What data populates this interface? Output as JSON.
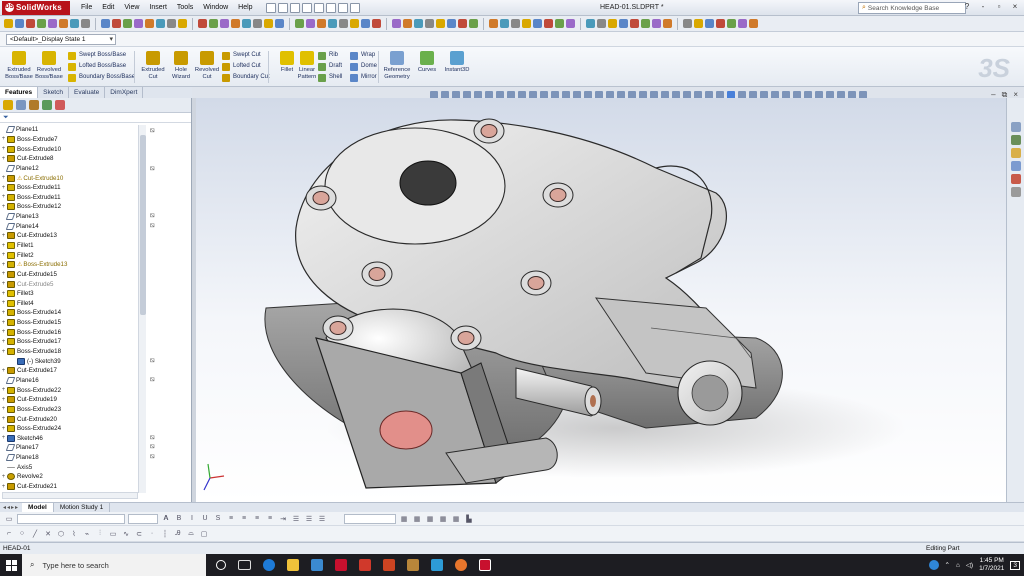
{
  "app": {
    "brand": "SolidWorks",
    "document_title": "HEAD-01.SLDPRT *",
    "menus": [
      "File",
      "Edit",
      "View",
      "Insert",
      "Tools",
      "Window",
      "Help"
    ],
    "search_placeholder": "Search Knowledge Base",
    "window_controls": [
      "?",
      "-",
      "▫",
      "×"
    ]
  },
  "config": {
    "value": "<Default>_Display State 1"
  },
  "ribbon": {
    "big_buttons": [
      {
        "label": "Extruded Boss/Base",
        "color": "#d8b400"
      },
      {
        "label": "Revolved Boss/Base",
        "color": "#d8b400"
      },
      {
        "label": "Extruded Cut",
        "color": "#c89a00"
      },
      {
        "label": "Hole Wizard",
        "color": "#c89a00"
      },
      {
        "label": "Revolved Cut",
        "color": "#c89a00"
      },
      {
        "label": "Fillet",
        "color": "#e0c000"
      },
      {
        "label": "Linear Pattern",
        "color": "#e0c000"
      },
      {
        "label": "Reference Geometry",
        "color": "#7aa0d0"
      },
      {
        "label": "Curves",
        "color": "#6ab04c"
      },
      {
        "label": "Instant3D",
        "color": "#5aa0d0"
      }
    ],
    "small_buttons": [
      {
        "label": "Swept Boss/Base"
      },
      {
        "label": "Lofted Boss/Base"
      },
      {
        "label": "Boundary Boss/Base"
      },
      {
        "label": "Swept Cut"
      },
      {
        "label": "Lofted Cut"
      },
      {
        "label": "Boundary Cut"
      },
      {
        "label": "Rib"
      },
      {
        "label": "Draft"
      },
      {
        "label": "Shell"
      },
      {
        "label": "Wrap"
      },
      {
        "label": "Dome"
      },
      {
        "label": "Mirror"
      }
    ]
  },
  "command_tabs": [
    {
      "label": "Features",
      "active": true
    },
    {
      "label": "Sketch",
      "active": false
    },
    {
      "label": "Evaluate",
      "active": false
    },
    {
      "label": "DimXpert",
      "active": false
    }
  ],
  "tree": [
    {
      "label": "Plane11",
      "type": "plane"
    },
    {
      "label": "Boss-Extrude7",
      "type": "boss"
    },
    {
      "label": "Boss-Extrude10",
      "type": "boss"
    },
    {
      "label": "Cut-Extrude8",
      "type": "cut"
    },
    {
      "label": "Plane12",
      "type": "plane"
    },
    {
      "label": "Cut-Extrude10",
      "type": "cut",
      "warn": true
    },
    {
      "label": "Boss-Extrude11",
      "type": "boss"
    },
    {
      "label": "Boss-Extrude11",
      "type": "boss"
    },
    {
      "label": "Boss-Extrude12",
      "type": "boss"
    },
    {
      "label": "Plane13",
      "type": "plane"
    },
    {
      "label": "Plane14",
      "type": "plane"
    },
    {
      "label": "Cut-Extrude13",
      "type": "cut"
    },
    {
      "label": "Fillet1",
      "type": "fillet"
    },
    {
      "label": "Fillet2",
      "type": "fillet"
    },
    {
      "label": "Boss-Extrude13",
      "type": "boss",
      "warn": true
    },
    {
      "label": "Cut-Extrude15",
      "type": "cut"
    },
    {
      "label": "Cut-Extrude5",
      "type": "cut",
      "suppressed": true
    },
    {
      "label": "Fillet3",
      "type": "fillet"
    },
    {
      "label": "Fillet4",
      "type": "fillet"
    },
    {
      "label": "Boss-Extrude14",
      "type": "boss"
    },
    {
      "label": "Boss-Extrude15",
      "type": "boss"
    },
    {
      "label": "Boss-Extrude16",
      "type": "boss"
    },
    {
      "label": "Boss-Extrude17",
      "type": "boss"
    },
    {
      "label": "Boss-Extrude18",
      "type": "boss"
    },
    {
      "label": "(-) Sketch39",
      "type": "sketch",
      "indent": true
    },
    {
      "label": "Cut-Extrude17",
      "type": "cut"
    },
    {
      "label": "Plane16",
      "type": "plane"
    },
    {
      "label": "Boss-Extrude22",
      "type": "boss"
    },
    {
      "label": "Cut-Extrude19",
      "type": "cut"
    },
    {
      "label": "Boss-Extrude23",
      "type": "boss"
    },
    {
      "label": "Cut-Extrude20",
      "type": "cut"
    },
    {
      "label": "Boss-Extrude24",
      "type": "boss"
    },
    {
      "label": "Sketch46",
      "type": "sketch"
    },
    {
      "label": "Plane17",
      "type": "plane"
    },
    {
      "label": "Plane18",
      "type": "plane"
    },
    {
      "label": "Axis5",
      "type": "axis"
    },
    {
      "label": "Revolve2",
      "type": "revolve"
    },
    {
      "label": "Cut-Extrude21",
      "type": "cut"
    }
  ],
  "model_tabs": [
    {
      "label": "Model",
      "active": true
    },
    {
      "label": "Motion Study 1",
      "active": false
    }
  ],
  "status": {
    "left": "HEAD-01",
    "right": "Editing Part"
  },
  "taskbar": {
    "search_placeholder": "Type here to search",
    "time": "1:45 PM",
    "date": "1/7/2021",
    "notification_count": "3"
  }
}
